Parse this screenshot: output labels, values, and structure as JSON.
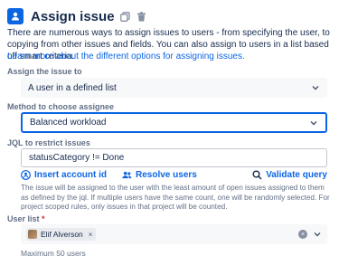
{
  "header": {
    "title": "Assign issue",
    "icon": "assign-issue-icon",
    "actions": [
      "copy-icon",
      "delete-icon"
    ]
  },
  "description": "There are numerous ways to assign issues to users - from specifying the user, to copying from other issues and fields. You can also assign to users in a list based off smart criteria.",
  "learn_more_link": "Learn more about the different options for assigning issues.",
  "assign_to": {
    "label": "Assign the issue to",
    "value": "A user in a defined list"
  },
  "method": {
    "label": "Method to choose assignee",
    "value": "Balanced workload"
  },
  "jql": {
    "label": "JQL to restrict issues",
    "value": "statusCategory != Done"
  },
  "jql_actions": {
    "insert_account_id": "Insert account id",
    "resolve_users": "Resolve users",
    "validate_query": "Validate query"
  },
  "help_text": "The issue will be assigned to the user with the least amount of open issues assigned to them as defined by the jql. If multiple users have the same count, one will be randomly selected. For project scoped rules, only issues in that project will be counted.",
  "user_list": {
    "label": "User list",
    "required_marker": "*",
    "users": [
      "Elif Alverson"
    ],
    "remove_glyph": "×",
    "clear_glyph": "×"
  },
  "max_note": "Maximum 50 users",
  "colors": {
    "accent": "#0c66e4",
    "text": "#172b4d",
    "subtle": "#626f86",
    "required": "#c9372c"
  }
}
